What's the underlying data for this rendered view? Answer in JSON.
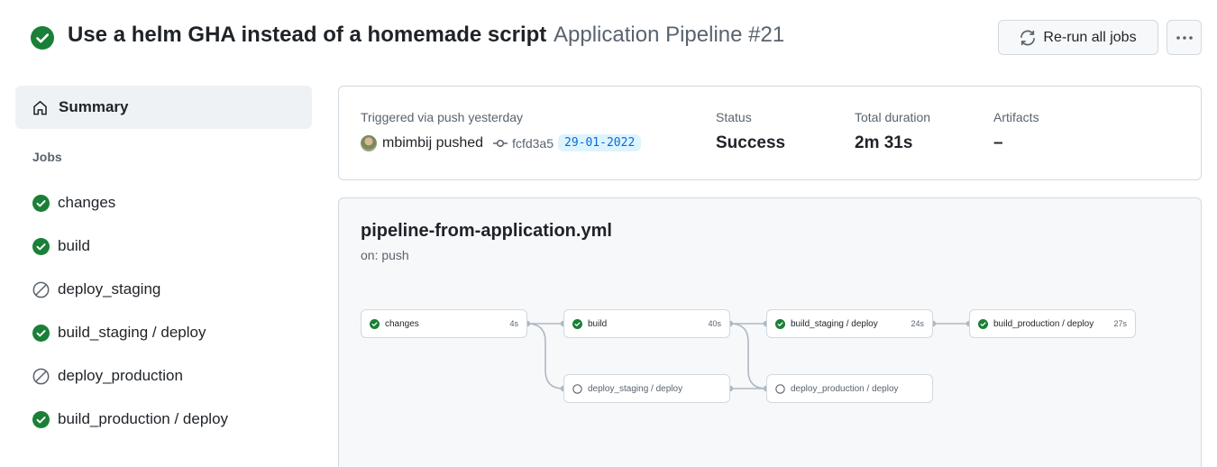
{
  "header": {
    "run_title": "Use a helm GHA instead of a homemade script",
    "workflow_run": "Application Pipeline #21",
    "rerun_label": "Re-run all jobs",
    "more_icon": "kebab-horizontal-icon",
    "title_status_icon": "check-circle-fill-icon"
  },
  "sidebar": {
    "summary_label": "Summary",
    "summary_icon": "home-icon",
    "jobs_heading": "Jobs",
    "jobs": [
      {
        "label": "changes",
        "status": "success"
      },
      {
        "label": "build",
        "status": "success"
      },
      {
        "label": "deploy_staging",
        "status": "skipped"
      },
      {
        "label": "build_staging / deploy",
        "status": "success"
      },
      {
        "label": "deploy_production",
        "status": "skipped"
      },
      {
        "label": "build_production / deploy",
        "status": "success"
      }
    ]
  },
  "summary": {
    "trigger_label": "Triggered via push yesterday",
    "actor": "mbimbij pushed",
    "commit_sha": "fcfd3a5",
    "commit_date": "29-01-2022",
    "status_label": "Status",
    "status_value": "Success",
    "duration_label": "Total duration",
    "duration_value": "2m 31s",
    "artifacts_label": "Artifacts",
    "artifacts_value": "–"
  },
  "graph": {
    "workflow_file": "pipeline-from-application.yml",
    "trigger": "on: push",
    "jobs": [
      {
        "name": "changes",
        "duration": "4s",
        "status": "success"
      },
      {
        "name": "build",
        "duration": "40s",
        "status": "success"
      },
      {
        "name": "build_staging / deploy",
        "duration": "24s",
        "status": "success"
      },
      {
        "name": "build_production / deploy",
        "duration": "27s",
        "status": "success"
      },
      {
        "name": "deploy_staging / deploy",
        "duration": "",
        "status": "skipped"
      },
      {
        "name": "deploy_production / deploy",
        "duration": "",
        "status": "skipped"
      }
    ]
  },
  "colors": {
    "success": "#1a7f37",
    "skipped": "#59636e",
    "link": "#0969da",
    "border": "#d1d9e0"
  }
}
